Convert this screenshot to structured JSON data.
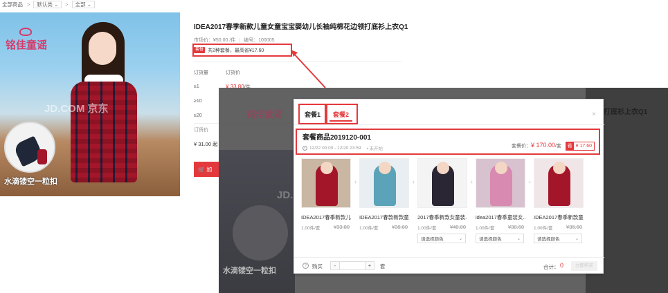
{
  "breadcrumb": {
    "root": "全部商品",
    "sort": "默认类",
    "filter": "全部"
  },
  "product": {
    "title": "IDEA2017春季新款儿童女童宝宝婴幼儿长袖纯棉花边领打底衫上衣Q1",
    "market_price_label": "市场价：",
    "market_price": "¥50.00 /件",
    "code_label": "编号：",
    "code": "100005",
    "promo_tag": "套餐",
    "promo_text": "共2种套餐，最高省¥17.60",
    "qty_header": "订货量",
    "price_header": "订货价",
    "tiers": [
      {
        "qty": "≥1",
        "price": "¥ 33.80",
        "unit": "/件"
      },
      {
        "qty": "≥10",
        "price": "",
        "unit": ""
      },
      {
        "qty": "≥20",
        "price": "",
        "unit": ""
      }
    ],
    "order_price_label": "订货价",
    "order_price": "¥ 31.00  起",
    "cart_button": "加",
    "brand": "铭佳童谣",
    "watermark": "JD.COM 京东",
    "image_caption": "水滴镂空一粒扣"
  },
  "modal": {
    "tabs": [
      {
        "label": "套餐1"
      },
      {
        "label": "套餐2"
      }
    ],
    "active_tab": 1,
    "close_symbol": "×",
    "bundle_name": "套餐商品2019120-001",
    "time_range": "12/22 00:00 - 12/20 23:59",
    "status": "• 未开始",
    "bundle_price_label": "套餐价：",
    "bundle_price": "¥ 170.00",
    "bundle_price_unit": "/套",
    "save_key": "省",
    "save_value": "¥ 17.60",
    "items": [
      {
        "name": "IDEA2017春季新款儿...",
        "qty": "1.00件/套",
        "old_price": "¥33.80",
        "select": "",
        "colors": [
          "#c9b6a3",
          "#a3162a"
        ]
      },
      {
        "name": "IDEA2017春款新款童...",
        "qty": "1.00件/套",
        "old_price": "¥38.60",
        "select": "",
        "colors": [
          "#e8eef2",
          "#5aa3b8"
        ]
      },
      {
        "name": "2017春季新款女童装...",
        "qty": "1.00件/套",
        "old_price": "¥40.00",
        "select": "请选择颜色",
        "colors": [
          "#f4f4f4",
          "#2a2633"
        ]
      },
      {
        "name": "idea2017春季童装女...",
        "qty": "1.00件/套",
        "old_price": "¥38.60",
        "select": "请选择颜色",
        "colors": [
          "#d9c2cf",
          "#d88ab0"
        ]
      },
      {
        "name": "IDEA2017春季新款童...",
        "qty": "1.00件/套",
        "old_price": "¥36.60",
        "select": "请选择颜色",
        "colors": [
          "#f0e6e8",
          "#a3162a"
        ]
      }
    ],
    "footer": {
      "help": "?",
      "buy_label": "购买",
      "minus": "-",
      "plus": "+",
      "unit": "套",
      "total_label": "合计：",
      "total_value": "0",
      "buy_button": "立即购买"
    },
    "ghost_title": "打底衫上衣Q1"
  },
  "colors": {
    "accent": "#e4393c"
  }
}
